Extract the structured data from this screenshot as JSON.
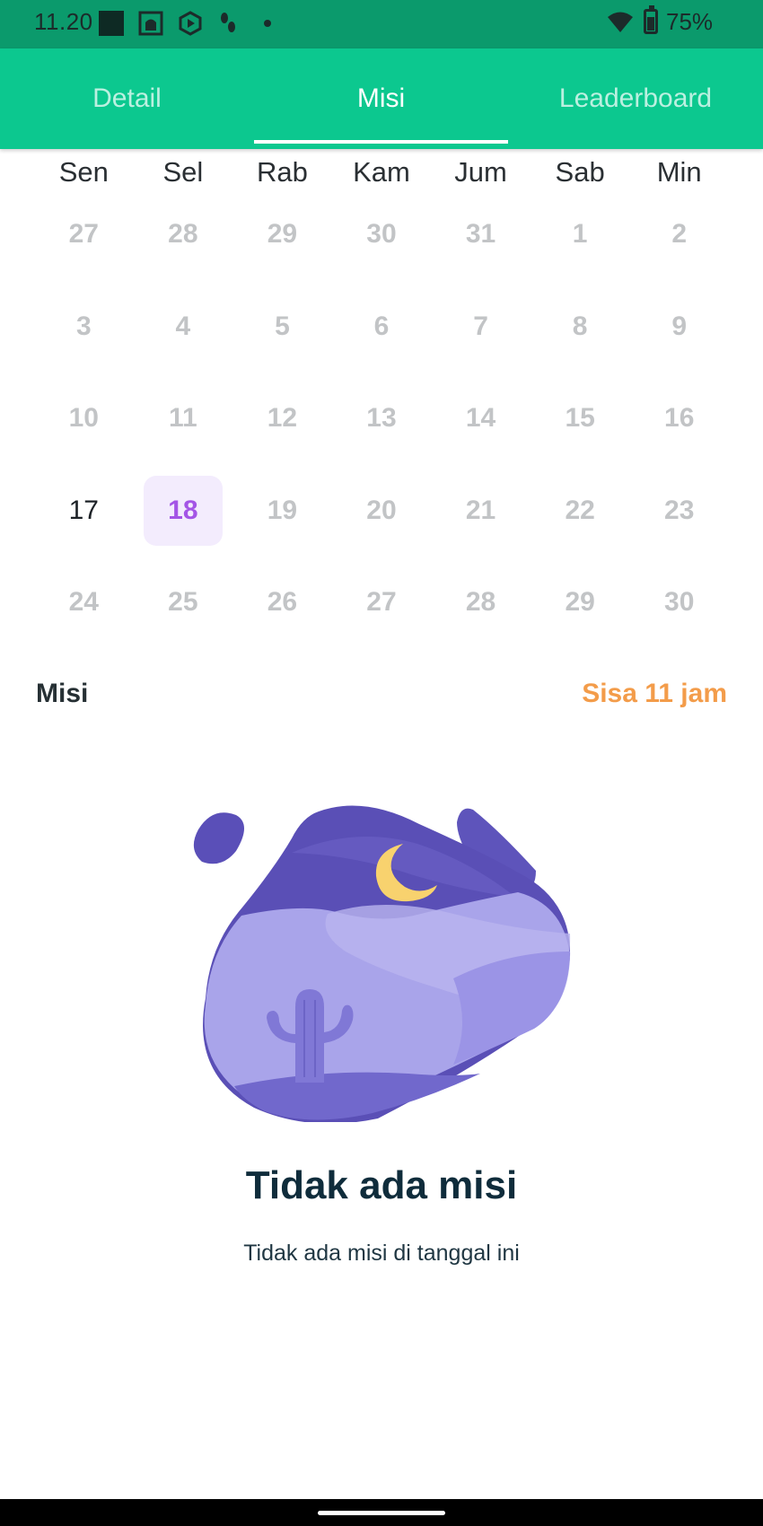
{
  "status_bar": {
    "time": "11.20",
    "battery": "75%",
    "icons": [
      "square-notification-icon",
      "mosque-app-icon",
      "hex-play-icon",
      "footprint-icon",
      "more-dot-icon",
      "wifi-icon",
      "battery-icon"
    ]
  },
  "tabs": [
    {
      "label": "Detail",
      "active": false
    },
    {
      "label": "Misi",
      "active": true
    },
    {
      "label": "Leaderboard",
      "active": false
    }
  ],
  "calendar": {
    "weekdays": [
      "Sen",
      "Sel",
      "Rab",
      "Kam",
      "Jum",
      "Sab",
      "Min"
    ],
    "days": [
      "27",
      "28",
      "29",
      "30",
      "31",
      "1",
      "2",
      "3",
      "4",
      "5",
      "6",
      "7",
      "8",
      "9",
      "10",
      "11",
      "12",
      "13",
      "14",
      "15",
      "16",
      "17",
      "18",
      "19",
      "20",
      "21",
      "22",
      "23",
      "24",
      "25",
      "26",
      "27",
      "28",
      "29",
      "30"
    ],
    "today_index": 21,
    "selected_index": 22
  },
  "mission": {
    "title": "Misi",
    "remaining": "Sisa 11 jam"
  },
  "empty_state": {
    "title": "Tidak ada misi",
    "subtitle": "Tidak ada misi di tanggal ini",
    "illustration": "desert-night-cactus-illustration"
  },
  "colors": {
    "status_bar": "#0b9a6c",
    "tab_bar": "#0cc88f",
    "accent_remaining": "#f39c4a",
    "selected_day": "#a455e6",
    "selected_day_bg": "#f3ecfd"
  }
}
